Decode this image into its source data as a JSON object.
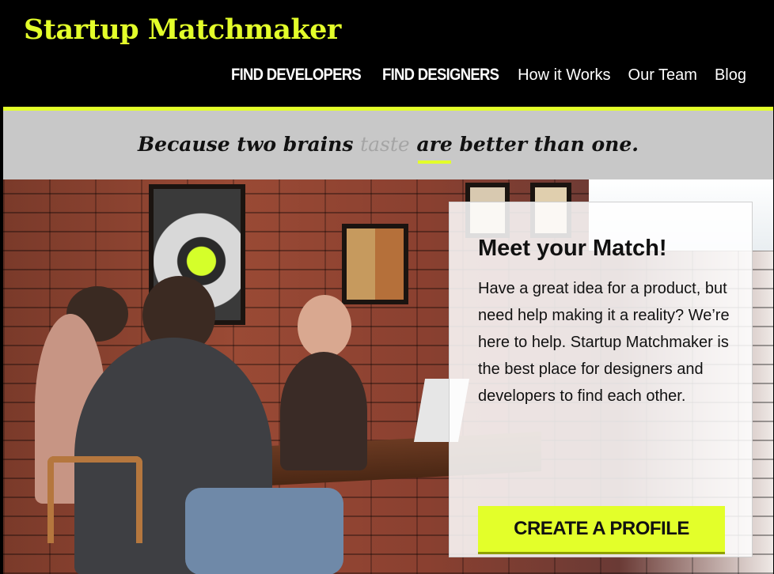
{
  "brand": {
    "logo_text": "Startup Matchmaker",
    "accent_color": "#e3ff2a"
  },
  "nav": {
    "items": [
      {
        "label": "FIND DEVELOPERS",
        "style": "strong"
      },
      {
        "label": "FIND DESIGNERS",
        "style": "strong"
      },
      {
        "label": "How it Works",
        "style": "plain"
      },
      {
        "label": "Our Team",
        "style": "plain"
      },
      {
        "label": "Blog",
        "style": "plain"
      }
    ]
  },
  "tagline": {
    "before": "Because two brains ",
    "struck": "taste",
    "space": " ",
    "underlined": "are",
    "after": " better than one."
  },
  "callout": {
    "title": "Meet your Match!",
    "body": "Have a great idea for a product, but need help making it a reality? We’re here to help. Startup Matchmaker is the best place for designers and developers to find each other.",
    "cta_label": "CREATE A PROFILE"
  }
}
